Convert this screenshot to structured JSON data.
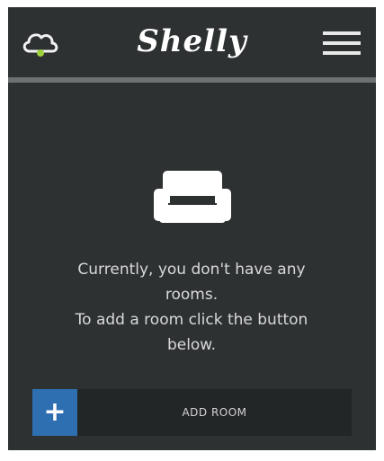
{
  "header": {
    "logo_text": "Shelly",
    "cloud_icon": "cloud-icon",
    "menu_icon": "hamburger-menu-icon",
    "cloud_status_color": "#9fd13c"
  },
  "empty_state": {
    "icon": "sofa-icon",
    "message_line1": "Currently, you don't have any",
    "message_line2": "rooms.",
    "message_line3": "To add a room click the button",
    "message_line4": "below."
  },
  "add_room": {
    "plus_label": "+",
    "label": "ADD ROOM",
    "accent_color": "#2e6fb1"
  }
}
